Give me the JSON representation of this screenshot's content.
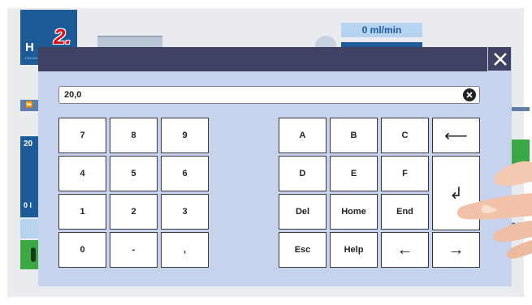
{
  "step": {
    "label": "2."
  },
  "background": {
    "logo_text": "H",
    "logo_sub": "PASSA",
    "flow_rate": "0 ml/min",
    "small_button": "⏩",
    "panel_top_value": "20",
    "panel_bottom_value": "0 l",
    "right_text": "pe"
  },
  "dialog": {
    "close_icon": "close-icon",
    "input": {
      "value": "20,0",
      "clear_icon": "clear-icon"
    },
    "numpad": {
      "keys": [
        {
          "label": "7"
        },
        {
          "label": "8"
        },
        {
          "label": "9"
        },
        {
          "label": "4"
        },
        {
          "label": "5"
        },
        {
          "label": "6"
        },
        {
          "label": "1"
        },
        {
          "label": "2"
        },
        {
          "label": "3"
        },
        {
          "label": "0"
        },
        {
          "label": "-"
        },
        {
          "label": ","
        }
      ]
    },
    "functions": {
      "keys": [
        {
          "label": "A"
        },
        {
          "label": "B"
        },
        {
          "label": "C"
        },
        {
          "label": "⟵",
          "icon": "backspace-icon"
        },
        {
          "label": "D"
        },
        {
          "label": "E"
        },
        {
          "label": "F"
        },
        {
          "label": "↲",
          "icon": "enter-icon"
        },
        {
          "label": "Del"
        },
        {
          "label": "Home"
        },
        {
          "label": "End"
        },
        {
          "label": "Esc"
        },
        {
          "label": "Help"
        },
        {
          "label": "←",
          "icon": "arrow-left-icon"
        },
        {
          "label": "→",
          "icon": "arrow-right-icon"
        }
      ]
    }
  },
  "colors": {
    "titlebar": "#3f4263",
    "dialog_bg": "#c7d2ec",
    "brand_blue": "#1c5a98",
    "step_red": "#d80f1c",
    "green": "#3aa845"
  }
}
